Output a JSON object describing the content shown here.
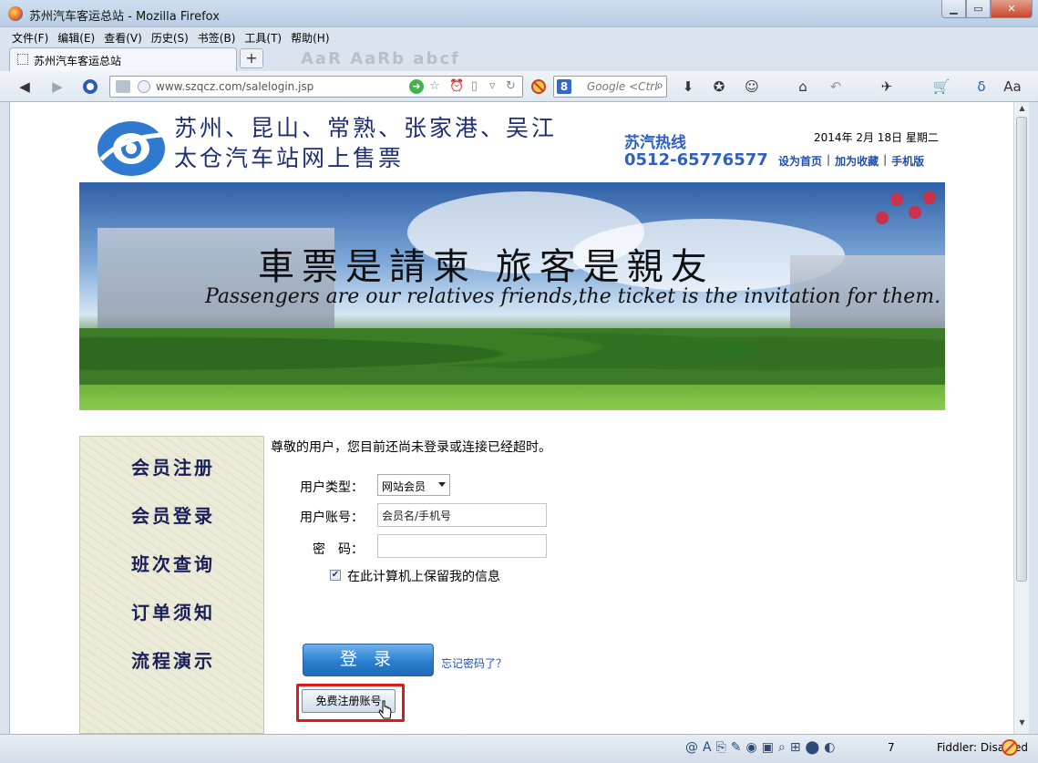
{
  "window": {
    "title": "苏州汽车客运总站 - Mozilla Firefox",
    "minimize": "▁",
    "maximize": "▭",
    "close": "✕"
  },
  "menubar": [
    "文件(F)",
    "编辑(E)",
    "查看(V)",
    "历史(S)",
    "书签(B)",
    "工具(T)",
    "帮助(H)"
  ],
  "tab": {
    "label": "苏州汽车客运总站",
    "new_tab": "+"
  },
  "faded_toolbar_text": "AaR AaRb abcf",
  "navbar": {
    "url": "www.szqcz.com/salelogin.jsp",
    "search_placeholder": "Google <Ctrl",
    "search_engine_letter": "8"
  },
  "site": {
    "title_line1": "苏州、昆山、常熟、张家港、吴江",
    "title_line2": "太仓汽车站网上售票",
    "hotline_label": "苏汽热线",
    "hotline_number": "0512-65776577",
    "date": "2014年 2月 18日 星期二",
    "links": [
      "设为首页",
      "加为收藏",
      "手机版"
    ],
    "link_separator": "|",
    "banner_slogan_cn": "車票是請柬  旅客是親友",
    "banner_slogan_en": "Passengers are our relatives friends,the ticket is the invitation for them."
  },
  "sidemenu": [
    "会员注册",
    "会员登录",
    "班次查询",
    "订单须知",
    "流程演示"
  ],
  "login": {
    "notice": "尊敬的用户，您目前还尚未登录或连接已经超时。",
    "user_type_label": "用户类型：",
    "user_type_value": "网站会员",
    "account_label": "用户账号：",
    "account_placeholder": "会员名/手机号",
    "password_label": "密　码：",
    "remember_label": "在此计算机上保留我的信息",
    "remember_checked": true,
    "login_button": "登 录",
    "forgot": "忘记密码了？",
    "register_button": "免费注册账号"
  },
  "statusbar": {
    "icons": [
      "@",
      "A",
      "⎘",
      "✎",
      "◉",
      "▣",
      "⌕",
      "⊞",
      "⬤",
      "◐"
    ],
    "count": "7",
    "fiddler": "Fiddler: Disabled"
  },
  "colors": {
    "accent_blue": "#2d5fc4",
    "title_navy": "#1e2f74",
    "highlight_red": "#e01818"
  }
}
